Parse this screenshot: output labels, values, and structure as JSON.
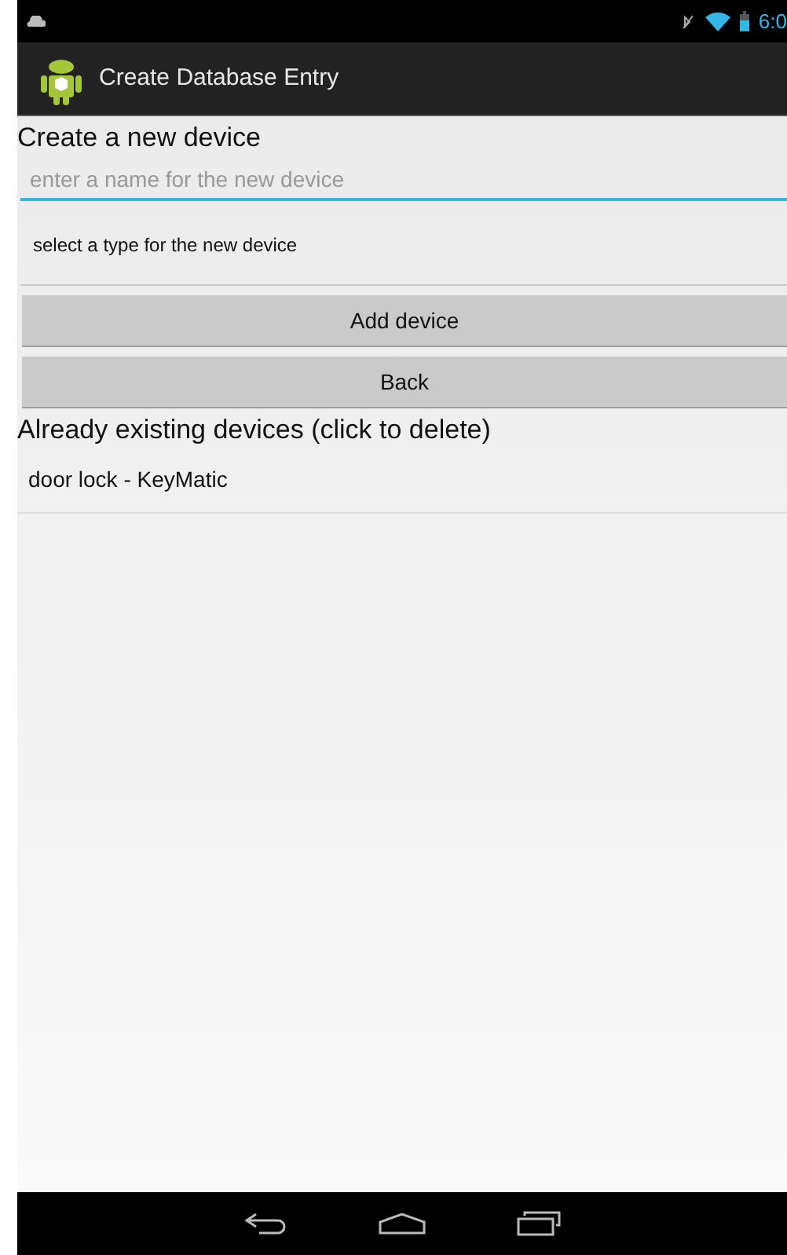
{
  "status_bar": {
    "time": "6:0"
  },
  "action_bar": {
    "title": "Create Database Entry"
  },
  "form": {
    "heading": "Create a new device",
    "name_field": {
      "placeholder": "enter a name for the new device"
    },
    "type_spinner": {
      "value": "select a type for the new device"
    },
    "buttons": [
      {
        "label": "Add device"
      },
      {
        "label": "Back"
      }
    ]
  },
  "devices": {
    "heading": "Already existing devices (click to delete)",
    "items": [
      {
        "label": "door lock - KeyMatic"
      }
    ]
  }
}
